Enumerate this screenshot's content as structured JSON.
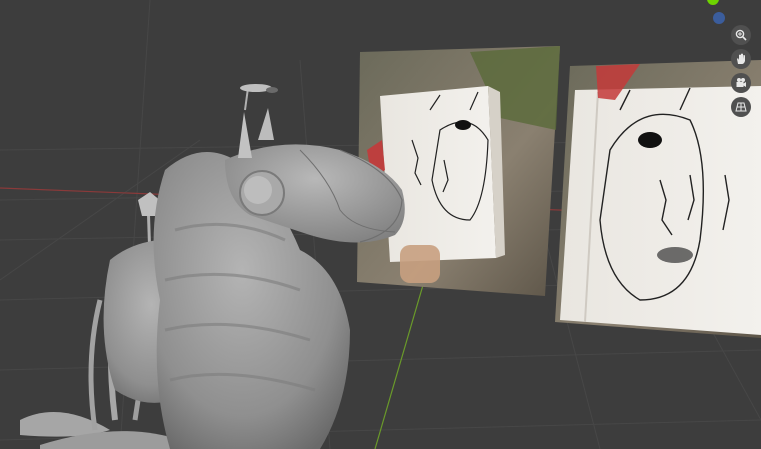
{
  "viewport": {
    "mode": "3d-viewport",
    "background_color": "#3d3d3d",
    "grid_color": "#474747",
    "axis_x_color": "#8a3a3a",
    "axis_y_color": "#6a9a2a"
  },
  "gizmo": {
    "y_axis_color": "#6ed400",
    "z_axis_color": "#3b5d9c"
  },
  "navigation": [
    {
      "icon": "zoom-icon"
    },
    {
      "icon": "hand-pan-icon"
    },
    {
      "icon": "camera-icon"
    },
    {
      "icon": "ortho-grid-icon"
    }
  ],
  "objects": [
    {
      "name": "sculpted-creature-model",
      "color": "#9a9a9a"
    },
    {
      "name": "reference-photo-1"
    },
    {
      "name": "reference-photo-2"
    }
  ]
}
